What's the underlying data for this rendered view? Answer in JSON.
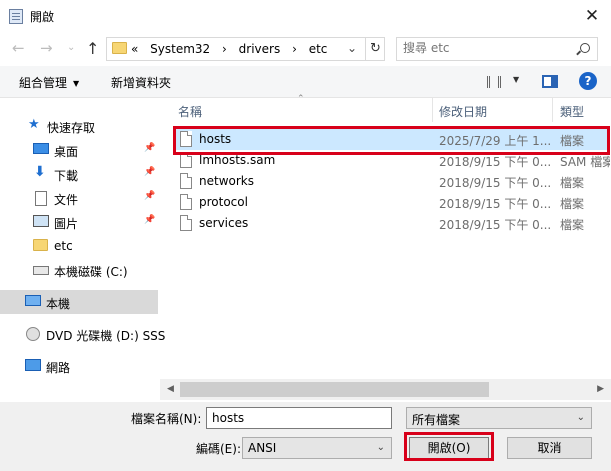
{
  "window": {
    "title": "開啟",
    "close_glyph": "✕"
  },
  "address": {
    "back_glyph": "←",
    "forward_glyph": "→",
    "history_glyph": "⌄",
    "up_glyph": "↑",
    "overflow": "«",
    "crumbs": [
      "System32",
      "drivers",
      "etc"
    ],
    "separator": "›",
    "dropdown_glyph": "⌄",
    "refresh_glyph": "↻",
    "search_placeholder": "搜尋 etc"
  },
  "toolbar": {
    "organize_label": "組合管理",
    "organize_caret": "▼",
    "new_folder_label": "新增資料夾",
    "view_caret": "▼",
    "help_label": "?"
  },
  "nav": {
    "pin_glyph": "📌",
    "quick_access": {
      "label": "快速存取",
      "icon": "★"
    },
    "items": [
      {
        "label": "桌面",
        "icon": "desktop-icon",
        "pinned": true
      },
      {
        "label": "下載",
        "icon": "download-icon",
        "glyph": "⬇",
        "pinned": true
      },
      {
        "label": "文件",
        "icon": "document-icon",
        "pinned": true
      },
      {
        "label": "圖片",
        "icon": "pictures-icon",
        "pinned": true
      },
      {
        "label": "etc",
        "icon": "folder-icon",
        "pinned": false
      },
      {
        "label": "本機磁碟 (C:)",
        "icon": "drive-icon",
        "pinned": false
      }
    ],
    "this_pc": "本機",
    "dvd": "DVD 光碟機 (D:) SSS",
    "network": "網路"
  },
  "files": {
    "columns": {
      "name": "名稱",
      "date": "修改日期",
      "type": "類型",
      "sort_glyph": "⌃"
    },
    "rows": [
      {
        "name": "hosts",
        "date": "2025/7/29 上午 1...",
        "type": "檔案",
        "selected": true
      },
      {
        "name": "lmhosts.sam",
        "date": "2018/9/15 下午 0...",
        "type": "SAM 檔案",
        "selected": false
      },
      {
        "name": "networks",
        "date": "2018/9/15 下午 0...",
        "type": "檔案",
        "selected": false
      },
      {
        "name": "protocol",
        "date": "2018/9/15 下午 0...",
        "type": "檔案",
        "selected": false
      },
      {
        "name": "services",
        "date": "2018/9/15 下午 0...",
        "type": "檔案",
        "selected": false
      }
    ],
    "scroll_left": "◀",
    "scroll_right": "▶"
  },
  "footer": {
    "filename_label": "檔案名稱(N):",
    "filename_value": "hosts",
    "filter_value": "所有檔案",
    "encoding_label": "編碼(E):",
    "encoding_value": "ANSI",
    "select_caret": "⌄",
    "open_label": "開啟(O)",
    "cancel_label": "取消"
  },
  "colors": {
    "selection": "#cce8ff",
    "highlight_box": "#d8001a",
    "accent": "#1a64c8"
  }
}
